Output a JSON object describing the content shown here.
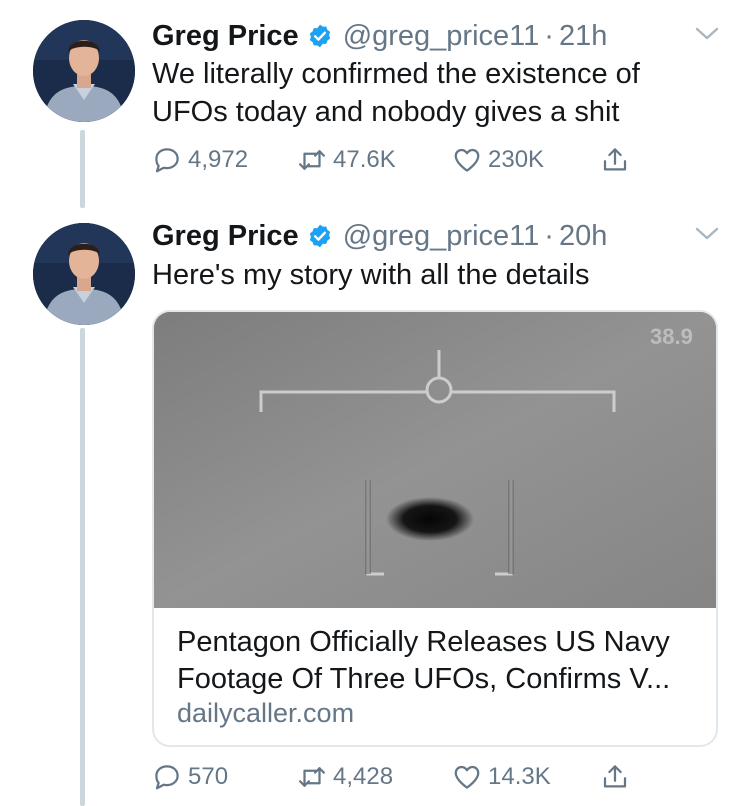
{
  "tweets": [
    {
      "name": "Greg Price",
      "handle": "@greg_price11",
      "time": "21h",
      "text": "We literally confirmed the existence of UFOs today and nobody gives a shit",
      "replies": "4,972",
      "retweets": "47.6K",
      "likes": "230K"
    },
    {
      "name": "Greg Price",
      "handle": "@greg_price11",
      "time": "20h",
      "text": "Here's my story with all the details",
      "card": {
        "title": "Pentagon Officially Releases US Navy Footage Of Three UFOs, Confirms V...",
        "domain": "dailycaller.com",
        "overlay_label": "38.9"
      },
      "replies": "570",
      "retweets": "4,428",
      "likes": "14.3K"
    }
  ],
  "colors": {
    "verified_blue": "#1da1f2",
    "muted_gray": "#657786",
    "thread_line": "#ccd6dd",
    "border": "#e1e8ed"
  },
  "icons": [
    "verified-badge-icon",
    "chevron-down-icon",
    "reply-icon",
    "retweet-icon",
    "like-icon",
    "share-icon"
  ]
}
